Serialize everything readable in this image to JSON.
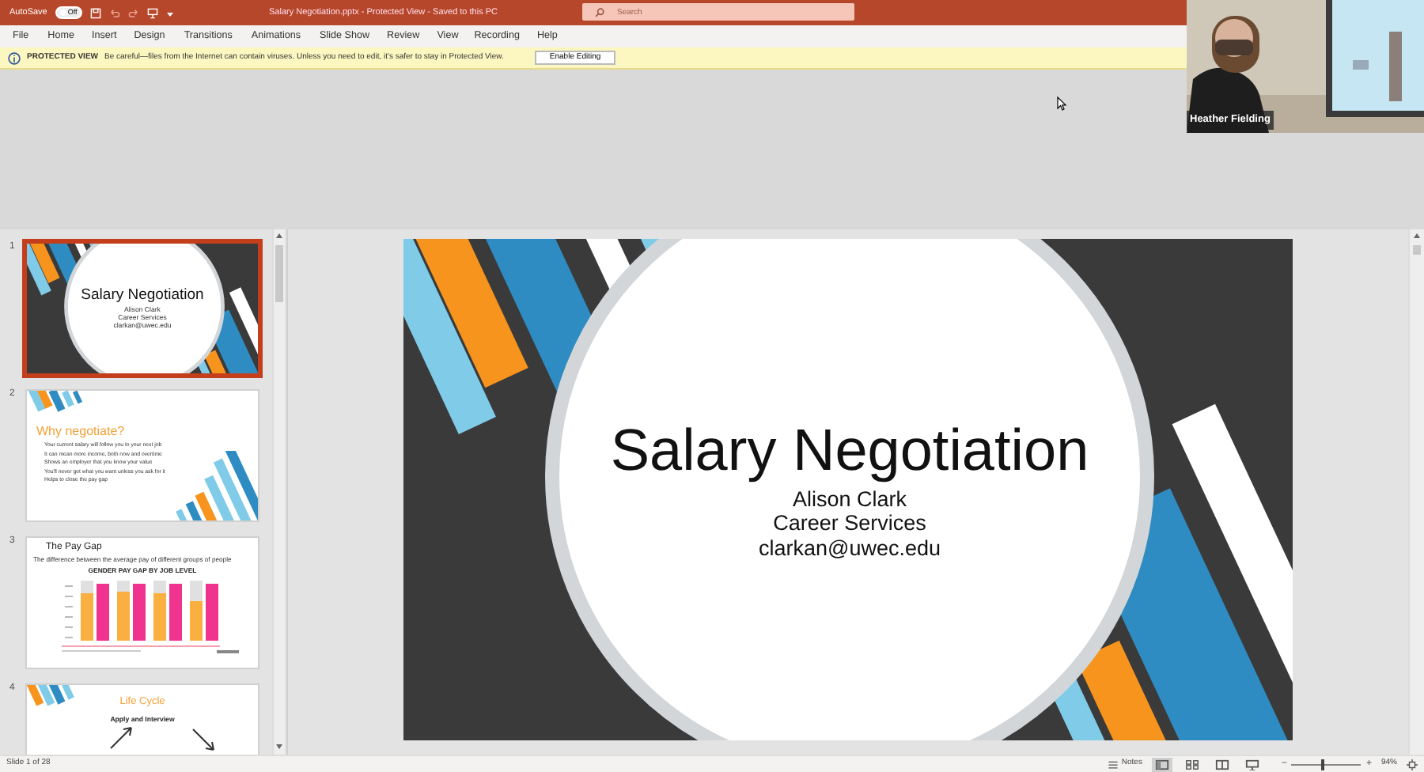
{
  "title_bar": {
    "autosave_label": "AutoSave",
    "autosave_toggle": {
      "label": "Off",
      "on": false
    },
    "title": "Salary Negotiation.pptx  -  Protected View  -  Saved to this PC",
    "search": {
      "placeholder": "Search"
    }
  },
  "menu": [
    "File",
    "Home",
    "Insert",
    "Design",
    "Transitions",
    "Animations",
    "Slide Show",
    "Review",
    "View",
    "Recording",
    "Help"
  ],
  "protected_view": {
    "heading": "PROTECTED VIEW",
    "message": "Be careful—files from the Internet can contain viruses. Unless you need to edit, it's safer to stay in Protected View.",
    "button": "Enable Editing"
  },
  "video_tile": {
    "kind": "picture",
    "name": "Heather Fielding"
  },
  "thumbnails": [
    {
      "number": "1",
      "selected": true,
      "kind": "title",
      "title": "Salary Negotiation",
      "lines": [
        "Alison Clark",
        "Career Services",
        "clarkan@uwec.edu"
      ]
    },
    {
      "number": "2",
      "selected": false,
      "kind": "bullets",
      "title": "Why negotiate?",
      "lines": [
        "Your current salary will follow you to your next job",
        "It can mean more income, both now and overtime",
        "Shows an employer that you know your value",
        "You'll never get what you want unless you ask for it",
        "Helps to close the pay gap"
      ]
    },
    {
      "number": "3",
      "selected": false,
      "kind": "chart",
      "title": "The Pay Gap",
      "lines": [
        "The difference between the average pay of different groups of people"
      ],
      "chart_title": "GENDER PAY GAP BY JOB LEVEL"
    },
    {
      "number": "4",
      "selected": false,
      "kind": "diagram",
      "title": "Life Cycle",
      "lines": [
        "Apply and Interview"
      ]
    }
  ],
  "slide": {
    "title": "Salary Negotiation",
    "lines": [
      "Alison Clark",
      "Career Services",
      "clarkan@uwec.edu"
    ]
  },
  "status_bar": {
    "slide_count": "Slide 1 of 28",
    "notes": "Notes",
    "views": [
      {
        "kind": "normal",
        "selected": true
      },
      {
        "kind": "sorter",
        "selected": false
      },
      {
        "kind": "reading",
        "selected": false
      },
      {
        "kind": "slideshow",
        "selected": false
      }
    ],
    "zoom_out": "−",
    "zoom": {
      "level": 0.45
    },
    "zoom_in": "+",
    "zoom_reading": "94%"
  }
}
